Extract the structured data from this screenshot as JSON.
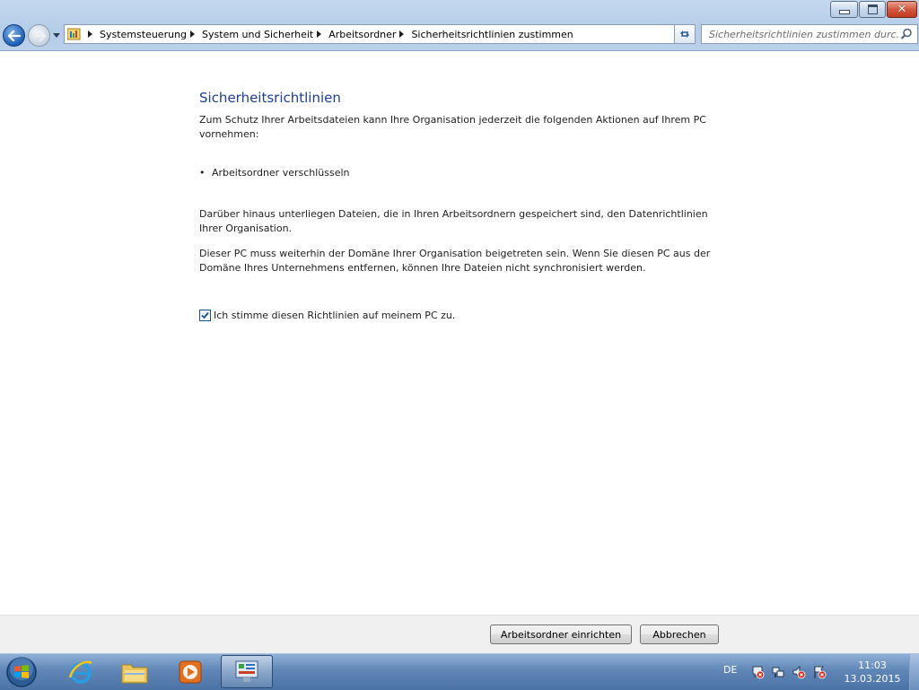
{
  "window": {
    "controls": {
      "minimize": "minimize",
      "maximize": "maximize",
      "close": "close"
    }
  },
  "navigation": {
    "breadcrumbs": [
      "Systemsteuerung",
      "System und Sicherheit",
      "Arbeitsordner",
      "Sicherheitsrichtlinien zustimmen"
    ]
  },
  "search": {
    "placeholder": "Sicherheitsrichtlinien zustimmen durc..."
  },
  "content": {
    "heading": "Sicherheitsrichtlinien",
    "intro": "Zum Schutz Ihrer Arbeitsdateien kann Ihre Organisation jederzeit die folgenden Aktionen auf Ihrem PC vornehmen:",
    "bullets": [
      "Arbeitsordner verschlüsseln"
    ],
    "policy_text": "Darüber hinaus unterliegen Dateien, die in Ihren Arbeitsordnern gespeichert sind, den Datenrichtlinien Ihrer Organisation.",
    "domain_text": "Dieser PC muss weiterhin der Domäne Ihrer Organisation beigetreten sein. Wenn Sie diesen PC aus der Domäne Ihres Unternehmens entfernen, können Ihre Dateien nicht synchronisiert werden.",
    "agree_label": "Ich stimme diesen Richtlinien auf meinem PC zu.",
    "agree_checked": true
  },
  "footer": {
    "setup_button": "Arbeitsordner einrichten",
    "cancel_button": "Abbrechen"
  },
  "taskbar": {
    "language": "DE",
    "time": "11:03",
    "date": "13.03.2015"
  },
  "colors": {
    "heading": "#1e3f94",
    "taskbar": "#5f86b6"
  }
}
